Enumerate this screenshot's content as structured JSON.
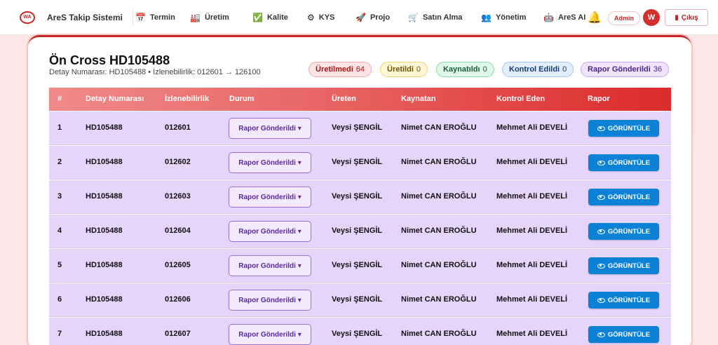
{
  "app": {
    "logo_text": "WA",
    "title": "AreS Takip Sistemi"
  },
  "nav": [
    {
      "icon": "calendar-icon",
      "glyph": "📅",
      "label": "Termin"
    },
    {
      "icon": "factory-icon",
      "glyph": "🏭",
      "label": "Üretim"
    },
    {
      "icon": "check-icon",
      "glyph": "✅",
      "label": "Kalite"
    },
    {
      "icon": "gear-icon",
      "glyph": "⚙",
      "label": "KYS"
    },
    {
      "icon": "rocket-icon",
      "glyph": "🚀",
      "label": "Projo"
    },
    {
      "icon": "cart-icon",
      "glyph": "🛒",
      "label": "Satın Alma"
    },
    {
      "icon": "users-icon",
      "glyph": "👥",
      "label": "Yönetim"
    },
    {
      "icon": "robot-icon",
      "glyph": "🤖",
      "label": "AreS AI"
    }
  ],
  "user": {
    "role": "Admin",
    "initial": "W",
    "logout_label": "Çıkış"
  },
  "page": {
    "title": "Ön Cross HD105488",
    "subtitle": "Detay Numarası: HD105488 • İzlenebilirlik: 012601 → 126100"
  },
  "status_pills": [
    {
      "label": "Üretilmedi",
      "count": "64",
      "bg": "#fde3e3",
      "border": "#f2a9a9",
      "color": "#a31515"
    },
    {
      "label": "Üretildi",
      "count": "0",
      "bg": "#fff6d6",
      "border": "#f0d472",
      "color": "#6d5500"
    },
    {
      "label": "Kaynatıldı",
      "count": "0",
      "bg": "#dff7e8",
      "border": "#8ed8ad",
      "color": "#1b5e38"
    },
    {
      "label": "Kontrol Edildi",
      "count": "0",
      "bg": "#e3eefc",
      "border": "#a6c5ee",
      "color": "#163d73"
    },
    {
      "label": "Rapor Gönderildi",
      "count": "36",
      "bg": "#efe4fc",
      "border": "#c7a6ef",
      "color": "#4d2689"
    }
  ],
  "table": {
    "headers": [
      "#",
      "Detay Numarası",
      "İzlenebilirlik",
      "Durum",
      "Üreten",
      "Kaynatan",
      "Kontrol Eden",
      "Rapor"
    ],
    "rows": [
      {
        "no": "1",
        "detail": "HD105488",
        "trace": "012601",
        "status": "Rapor Gönderildi ▾",
        "producer": "Veysi ŞENGİL",
        "welder": "Nimet CAN EROĞLU",
        "inspector": "Mehmet Ali DEVELİ",
        "action": "GÖRÜNTÜLE"
      },
      {
        "no": "2",
        "detail": "HD105488",
        "trace": "012602",
        "status": "Rapor Gönderildi ▾",
        "producer": "Veysi ŞENGİL",
        "welder": "Nimet CAN EROĞLU",
        "inspector": "Mehmet Ali DEVELİ",
        "action": "GÖRÜNTÜLE"
      },
      {
        "no": "3",
        "detail": "HD105488",
        "trace": "012603",
        "status": "Rapor Gönderildi ▾",
        "producer": "Veysi ŞENGİL",
        "welder": "Nimet CAN EROĞLU",
        "inspector": "Mehmet Ali DEVELİ",
        "action": "GÖRÜNTÜLE"
      },
      {
        "no": "4",
        "detail": "HD105488",
        "trace": "012604",
        "status": "Rapor Gönderildi ▾",
        "producer": "Veysi ŞENGİL",
        "welder": "Nimet CAN EROĞLU",
        "inspector": "Mehmet Ali DEVELİ",
        "action": "GÖRÜNTÜLE"
      },
      {
        "no": "5",
        "detail": "HD105488",
        "trace": "012605",
        "status": "Rapor Gönderildi ▾",
        "producer": "Veysi ŞENGİL",
        "welder": "Nimet CAN EROĞLU",
        "inspector": "Mehmet Ali DEVELİ",
        "action": "GÖRÜNTÜLE"
      },
      {
        "no": "6",
        "detail": "HD105488",
        "trace": "012606",
        "status": "Rapor Gönderildi ▾",
        "producer": "Veysi ŞENGİL",
        "welder": "Nimet CAN EROĞLU",
        "inspector": "Mehmet Ali DEVELİ",
        "action": "GÖRÜNTÜLE"
      },
      {
        "no": "7",
        "detail": "HD105488",
        "trace": "012607",
        "status": "Rapor Gönderildi ▾",
        "producer": "Veysi ŞENGİL",
        "welder": "Nimet CAN EROĞLU",
        "inspector": "Mehmet Ali DEVELİ",
        "action": "GÖRÜNTÜLE"
      }
    ]
  }
}
